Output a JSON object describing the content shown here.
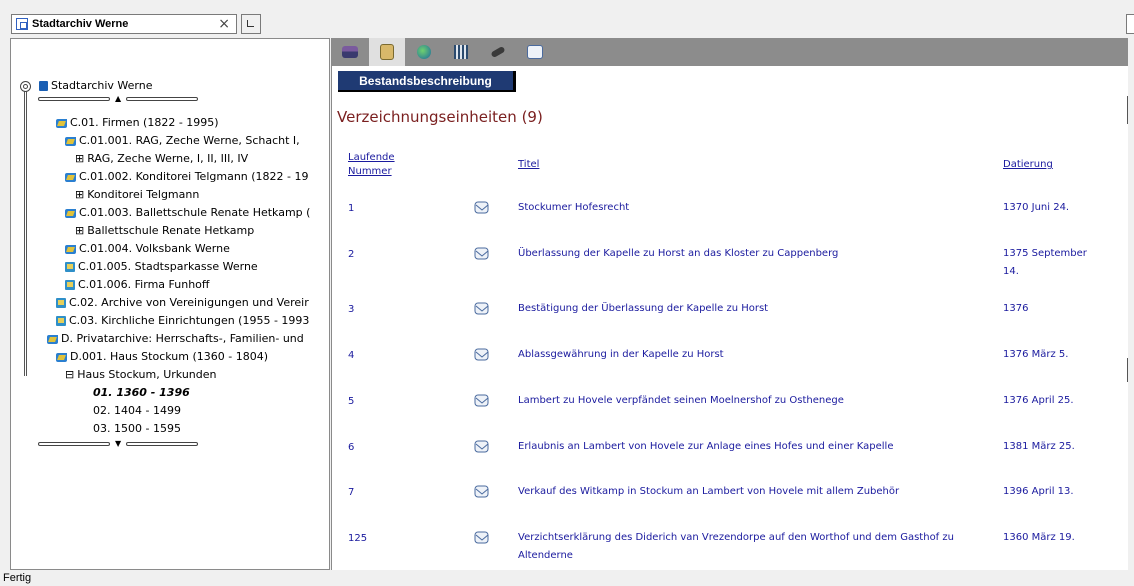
{
  "window": {
    "tab_title": "Stadtarchiv Werne",
    "close_glyph": "×"
  },
  "tree": {
    "root": "Stadtarchiv Werne",
    "nodes": [
      "C.01. Firmen (1822 - 1995)",
      "C.01.001. RAG, Zeche Werne, Schacht I,",
      "RAG, Zeche Werne, I, II, III, IV",
      "C.01.002. Konditorei Telgmann (1822 - 19",
      "Konditorei Telgmann",
      "C.01.003. Ballettschule Renate Hetkamp (",
      "Ballettschule Renate Hetkamp",
      "C.01.004. Volksbank Werne",
      "C.01.005. Stadtsparkasse Werne",
      "C.01.006. Firma Funhoff",
      "C.02. Archive von Vereinigungen und Vereir",
      "C.03. Kirchliche Einrichtungen (1955 - 1993",
      "D. Privatarchive: Herrschafts-, Familien- und",
      "D.001. Haus Stockum (1360 - 1804)",
      "Haus Stockum, Urkunden",
      "01. 1360 - 1396",
      "02. 1404 - 1499",
      "03. 1500 - 1595"
    ]
  },
  "toolbar": {
    "icons": [
      "house-book-icon",
      "documents-icon",
      "globe-icon",
      "building-icon",
      "pen-icon",
      "envelope-icon"
    ],
    "colors": {
      "strip": "#8c8c8c",
      "active": "#e0e0e0"
    }
  },
  "section_button": "Bestandsbeschreibung",
  "heading": "Verzeichnungseinheiten (9)",
  "table": {
    "headers": {
      "number_line1": "Laufende",
      "number_line2": "Nummer",
      "title": "Titel",
      "date": "Datierung"
    },
    "rows": [
      {
        "num": "1",
        "title": "Stockumer Hofesrecht",
        "date": "1370 Juni 24."
      },
      {
        "num": "2",
        "title": "Überlassung der Kapelle zu Horst an das Kloster zu Cappenberg",
        "date": "1375 September 14."
      },
      {
        "num": "3",
        "title": "Bestätigung der Überlassung der Kapelle zu Horst",
        "date": "1376"
      },
      {
        "num": "4",
        "title": "Ablassgewährung in der Kapelle zu Horst",
        "date": "1376 März 5."
      },
      {
        "num": "5",
        "title": "Lambert zu Hovele verpfändet seinen Moelnershof zu Osthenege",
        "date": "1376 April 25."
      },
      {
        "num": "6",
        "title": "Erlaubnis an Lambert von Hovele zur Anlage eines Hofes und einer Kapelle",
        "date": "1381 März 25."
      },
      {
        "num": "7",
        "title": "Verkauf des Witkamp in Stockum an Lambert von Hovele mit allem Zubehör",
        "date": "1396 April 13."
      },
      {
        "num": "125",
        "title": "Verzichtserklärung des Diderich van Vrezendorpe auf den Worthof und dem Gasthof zu Altenderne",
        "date": "1360 März 19."
      }
    ]
  },
  "status": "Fertig",
  "colors": {
    "link": "#1a1a9e",
    "heading": "#7a1f1f",
    "section_button": "#1f3a73"
  }
}
